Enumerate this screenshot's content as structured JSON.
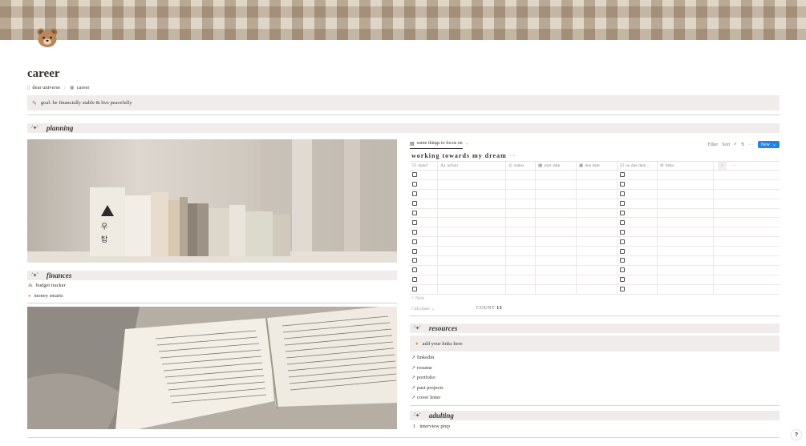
{
  "page": {
    "title": "career",
    "breadcrumb": [
      "dear universe",
      "career"
    ],
    "callout": "goal: be financially stable & live peacefully"
  },
  "sections": {
    "planning": "planning",
    "finances": "finances",
    "resources": "resources",
    "adulting": "adulting"
  },
  "finances_links": [
    "budget tracker",
    "money smarts"
  ],
  "database": {
    "view_name": "some things to focus on",
    "add_view": "+",
    "toolbar": {
      "filter": "Filter",
      "sort": "Sort",
      "search_icon": "⌕",
      "bolt_icon": "↯",
      "more": "···",
      "new_label": "New"
    },
    "title": "working towards my dream",
    "title_more": "···",
    "columns": [
      "done?",
      "action",
      "status",
      "start date",
      "due date",
      "no due date...",
      "links"
    ],
    "column_icons": [
      "☑",
      "Aa",
      "◎",
      "▦",
      "▦",
      "☑",
      "⊘"
    ],
    "row_count": 13,
    "new_row": "+ New",
    "calculate": "Calculate ⌄",
    "count_label": "COUNT",
    "count_value": "13"
  },
  "resources": {
    "callout": "add your links here",
    "links": [
      "linkedin",
      "resume",
      "portfolio",
      "past projects",
      "cover letter"
    ]
  },
  "adulting": {
    "items": [
      {
        "num": "1",
        "text": "interview prep"
      }
    ]
  },
  "help_label": "?"
}
